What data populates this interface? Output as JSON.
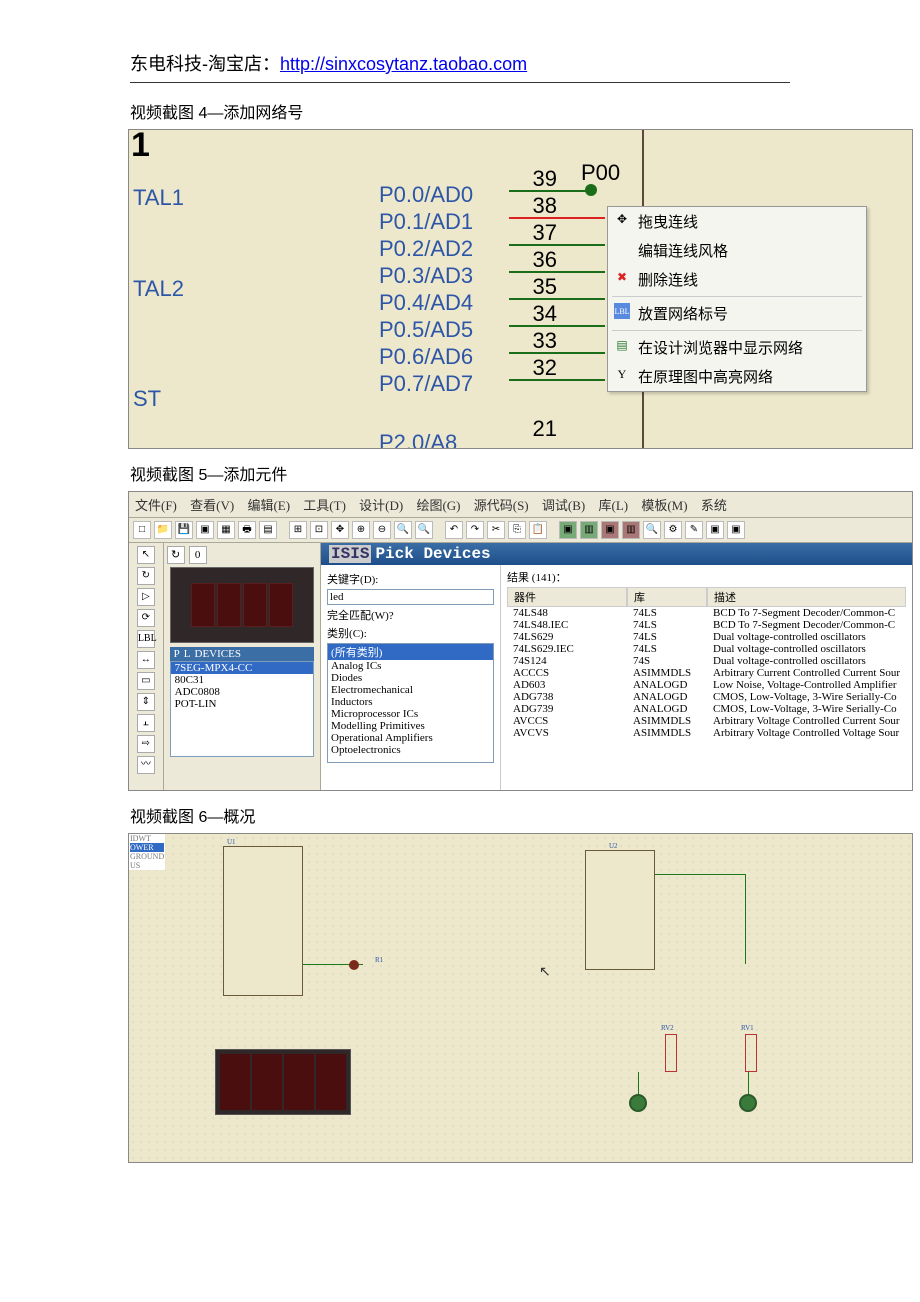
{
  "header": {
    "prefix": "东电科技-淘宝店：",
    "url": "http://sinxcosytanz.taobao.com"
  },
  "caption4": "视频截图 4—添加网络号",
  "caption5": "视频截图 5—添加元件",
  "caption6": "视频截图 6—概况",
  "s4": {
    "one": "1",
    "leftLabels": [
      "TAL1",
      "TAL2",
      "ST"
    ],
    "ports": [
      "P0.0/AD0",
      "P0.1/AD1",
      "P0.2/AD2",
      "P0.3/AD3",
      "P0.4/AD4",
      "P0.5/AD5",
      "P0.6/AD6",
      "P0.7/AD7"
    ],
    "lastport": "P2.0/A8",
    "pins": [
      "39",
      "38",
      "37",
      "36",
      "35",
      "34",
      "33",
      "32",
      "21"
    ],
    "p00": "P00",
    "menu": [
      "拖曳连线",
      "编辑连线风格",
      "删除连线",
      "放置网络标号",
      "在设计浏览器中显示网络",
      "在原理图中高亮网络"
    ]
  },
  "s5": {
    "menus": [
      "文件(F)",
      "查看(V)",
      "编辑(E)",
      "工具(T)",
      "设计(D)",
      "绘图(G)",
      "源代码(S)",
      "调试(B)",
      "库(L)",
      "模板(M)",
      "系统"
    ],
    "devHdr": [
      "P",
      "L",
      "DEVICES"
    ],
    "devs": [
      "7SEG-MPX4-CC",
      "80C31",
      "ADC0808",
      "POT-LIN"
    ],
    "pickTitle": "Pick Devices",
    "kwLabel": "关键字(D):",
    "kw": "led",
    "matchLabel": "完全匹配(W)?",
    "catLabel": "类别(C):",
    "cats": [
      "(所有类别)",
      "Analog ICs",
      "Diodes",
      "Electromechanical",
      "Inductors",
      "Microprocessor ICs",
      "Modelling Primitives",
      "Operational Amplifiers",
      "Optoelectronics"
    ],
    "resLabel": "结果 (141)：",
    "cols": [
      "器件",
      "库",
      "描述"
    ],
    "rows": [
      [
        "74LS48",
        "74LS",
        "BCD To 7-Segment Decoder/Common-C"
      ],
      [
        "74LS48.IEC",
        "74LS",
        "BCD To 7-Segment Decoder/Common-C"
      ],
      [
        "74LS629",
        "74LS",
        "Dual voltage-controlled oscillators"
      ],
      [
        "74LS629.IEC",
        "74LS",
        "Dual voltage-controlled oscillators"
      ],
      [
        "74S124",
        "74S",
        "Dual voltage-controlled oscillators"
      ],
      [
        "ACCCS",
        "ASIMMDLS",
        "Arbitrary Current Controlled Current Sour"
      ],
      [
        "AD603",
        "ANALOGD",
        "Low Noise, Voltage-Controlled Amplifier"
      ],
      [
        "ADG738",
        "ANALOGD",
        "CMOS, Low-Voltage, 3-Wire Serially-Co"
      ],
      [
        "ADG739",
        "ANALOGD",
        "CMOS, Low-Voltage, 3-Wire Serially-Co"
      ],
      [
        "AVCCS",
        "ASIMMDLS",
        "Arbitrary Voltage Controlled Current Sour"
      ],
      [
        "AVCVS",
        "ASIMMDLS",
        "Arbitrary Voltage Controlled Voltage Sour"
      ]
    ]
  },
  "s6": {
    "side": [
      "IDWT",
      "OWER",
      "GROUND",
      "US"
    ],
    "u1": "U1",
    "u2": "U2",
    "rv1": "RV1",
    "rv2": "RV2",
    "r1": "R1"
  }
}
